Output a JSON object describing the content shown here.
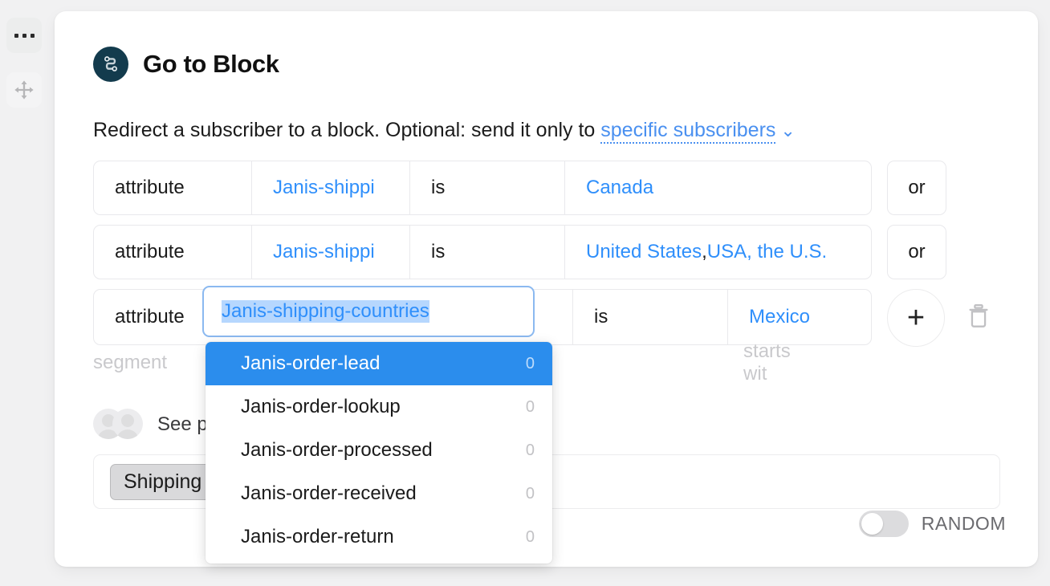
{
  "rail": {
    "more_icon": "ellipsis-icon",
    "move_icon": "move-arrows-icon"
  },
  "header": {
    "icon": "route-block-icon",
    "title": "Go to Block"
  },
  "description": {
    "text": "Redirect a subscriber to a block. Optional: send it only to ",
    "link": "specific subscribers",
    "chevron": "⌄"
  },
  "conditions": {
    "rows": [
      {
        "attribute_label": "attribute",
        "attribute_name": "Janis-shippi",
        "operator": "is",
        "value": "Canada",
        "value_suffix": "",
        "action": "or"
      },
      {
        "attribute_label": "attribute",
        "attribute_name": "Janis-shippi",
        "operator": "is",
        "value": "United States",
        "value_comma": ",",
        "value_suffix": " USA, the U.S.",
        "action": "or"
      },
      {
        "attribute_label": "attribute",
        "attribute_name": "Janis-shipping-countries",
        "operator": "is",
        "value": "Mexico",
        "add_button": "+",
        "delete_icon": "trash-icon"
      }
    ]
  },
  "ghost_row": {
    "left": "segment",
    "right": "starts wit"
  },
  "see_people": {
    "text": "See pe",
    "avatar_icon": "avatar-icon"
  },
  "shipping": {
    "chip_label": "Shipping"
  },
  "random": {
    "label": "RANDOM",
    "enabled": false
  },
  "dropdown": {
    "items": [
      {
        "label": "Janis-order-lead",
        "count": "0",
        "selected": true
      },
      {
        "label": "Janis-order-lookup",
        "count": "0",
        "selected": false
      },
      {
        "label": "Janis-order-processed",
        "count": "0",
        "selected": false
      },
      {
        "label": "Janis-order-received",
        "count": "0",
        "selected": false
      },
      {
        "label": "Janis-order-return",
        "count": "0",
        "selected": false
      }
    ]
  },
  "colors": {
    "accent_blue": "#2f8ffb",
    "highlight_blue": "#2b8ded",
    "selection_blue": "#b6d7fe",
    "icon_navy": "#133b4d",
    "page_bg": "#f1f1f2"
  }
}
